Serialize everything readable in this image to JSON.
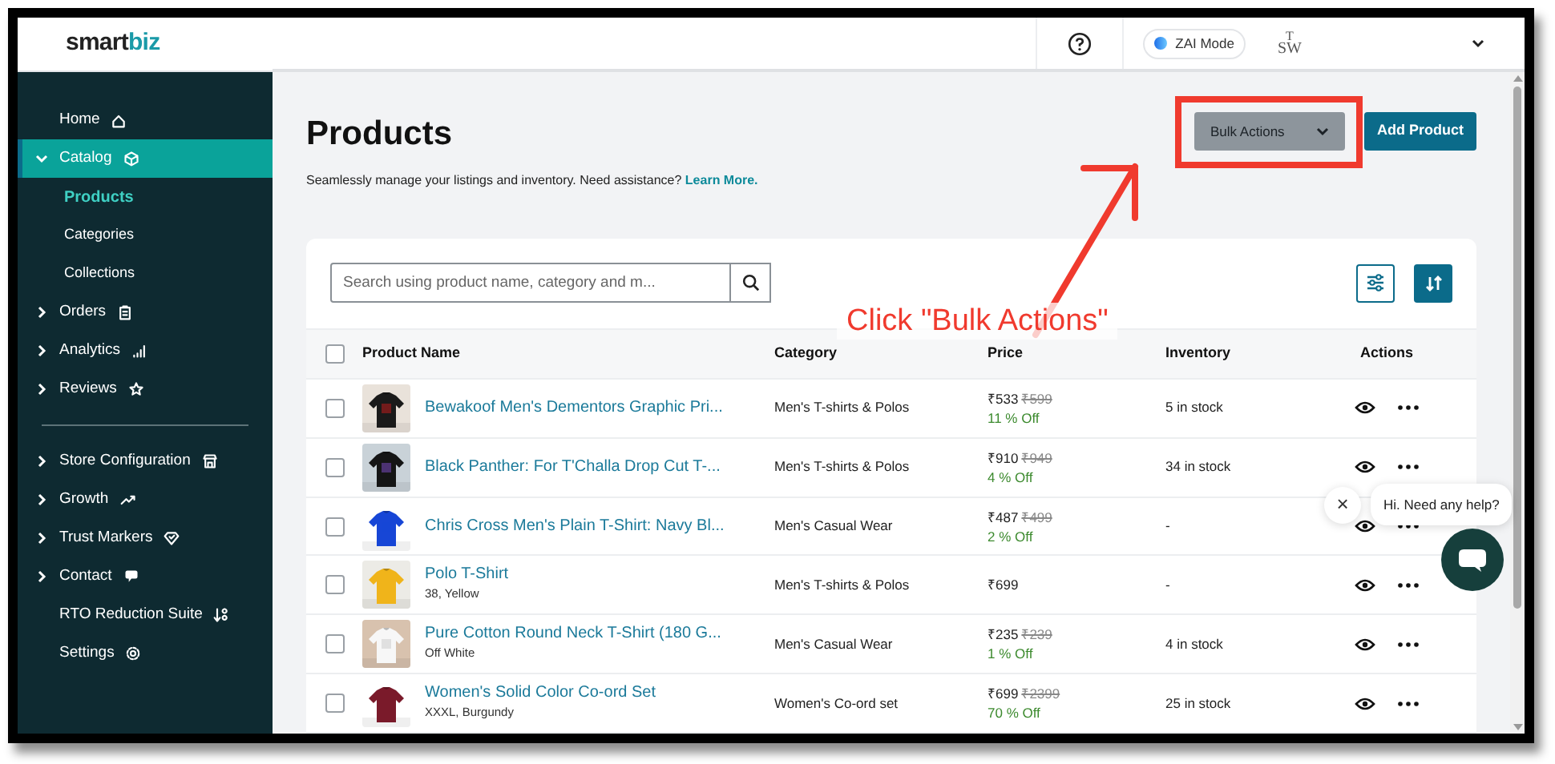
{
  "sidebar": {
    "logo": {
      "main": "smart",
      "accent": "biz"
    },
    "sections": [
      [
        {
          "label": "Home",
          "kind": "link",
          "selected": false
        },
        {
          "label": "Catalog",
          "kind": "group",
          "expanded": true,
          "selected": true,
          "children": [
            {
              "label": "Products",
              "selected": true
            },
            {
              "label": "Categories",
              "selected": false
            },
            {
              "label": "Collections",
              "selected": false
            }
          ]
        },
        {
          "label": "Orders",
          "kind": "group",
          "expanded": false,
          "selected": false
        },
        {
          "label": "Analytics",
          "kind": "group",
          "expanded": false,
          "selected": false
        },
        {
          "label": "Reviews",
          "kind": "group",
          "expanded": false,
          "selected": false
        }
      ],
      [
        {
          "label": "Store Configuration",
          "kind": "group",
          "expanded": false,
          "selected": false
        },
        {
          "label": "Growth",
          "kind": "group",
          "expanded": false,
          "selected": false
        },
        {
          "label": "Trust Markers",
          "kind": "group",
          "expanded": false,
          "selected": false
        },
        {
          "label": "Contact",
          "kind": "group",
          "expanded": false,
          "selected": false
        },
        {
          "label": "RTO Reduction Suite",
          "kind": "link",
          "selected": false
        },
        {
          "label": "Settings",
          "kind": "link",
          "selected": false
        }
      ]
    ]
  },
  "header": {
    "mode_label": "ZAI Mode",
    "store_logo": {
      "top": "T",
      "bottom": "SW"
    }
  },
  "page": {
    "title": "Products",
    "subtitle": "Seamlessly manage your listings and inventory. Need assistance?",
    "link": "Learn More.",
    "buttons": [
      {
        "label": "Bulk Actions",
        "kind": "dropdown"
      },
      {
        "label": "Add Product",
        "kind": "primary"
      }
    ]
  },
  "search": {
    "placeholder": "Search using product name, category and m..."
  },
  "table": {
    "select_all": {
      "checked": false
    },
    "columns": [
      "Product Name",
      "Category",
      "Price",
      "Inventory",
      "Actions"
    ],
    "rows": [
      {
        "name": "Bewakoof Men's Dementors Graphic Pri...",
        "category": "Men's T-shirts & Polos",
        "price": "₹533",
        "mrp": "₹599",
        "discount": "11 % Off",
        "inventory": "5 in stock",
        "checked": false
      },
      {
        "name": "Black Panther: For T'Challa Drop Cut T-...",
        "category": "Men's T-shirts & Polos",
        "price": "₹910",
        "mrp": "₹949",
        "discount": "4 % Off",
        "inventory": "34 in stock",
        "checked": false
      },
      {
        "name": "Chris Cross Men's Plain T-Shirt: Navy Bl...",
        "category": "Men's Casual Wear",
        "price": "₹487",
        "mrp": "₹499",
        "discount": "2 % Off",
        "inventory": "-",
        "checked": false
      },
      {
        "name": "Polo T-Shirt",
        "variant": "38, Yellow",
        "category": "Men's T-shirts & Polos",
        "price": "₹699",
        "inventory": "-",
        "checked": false
      },
      {
        "name": "Pure Cotton Round Neck T-Shirt (180 G...",
        "variant": "Off White",
        "category": "Men's Casual Wear",
        "price": "₹235",
        "mrp": "₹239",
        "discount": "1 % Off",
        "inventory": "4 in stock",
        "checked": false
      },
      {
        "name": "Women's Solid Color Co-ord Set",
        "variant": "XXXL, Burgundy",
        "category": "Women's Co-ord set",
        "price": "₹699",
        "mrp": "₹2399",
        "discount": "70 % Off",
        "inventory": "25 in stock",
        "checked": false
      }
    ]
  },
  "chat": {
    "message": "Hi. Need any help?",
    "close": "×"
  },
  "annotation": {
    "label": "Click \"Bulk Actions\""
  }
}
